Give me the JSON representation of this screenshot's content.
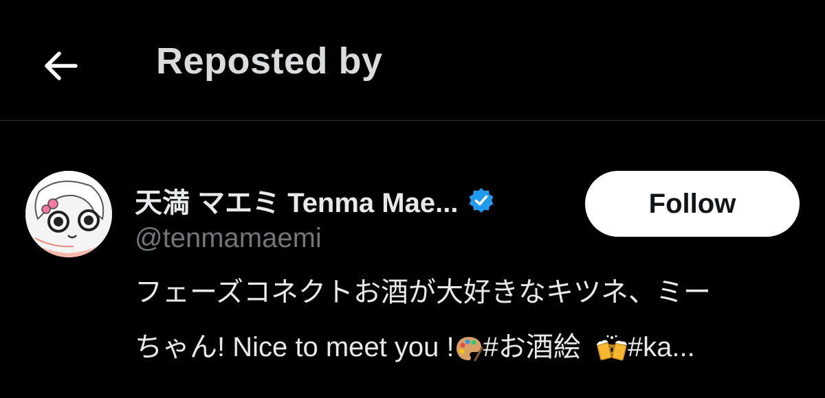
{
  "header": {
    "title": "Reposted by",
    "back_icon": "arrow-left-icon"
  },
  "user": {
    "display_name": "天満 マエミ Tenma Mae...",
    "verified_icon": "verified-badge-icon",
    "verified_color": "#1d9bf0",
    "handle": "@tenmamaemi",
    "follow_label": "Follow",
    "bio_line1": "フェーズコネクトお酒が大好きなキツネ、ミー",
    "bio_line2_part1": "ちゃん! Nice to meet you !",
    "bio_emoji1": "artist-palette-icon",
    "bio_line2_part2": "#お酒絵",
    "bio_emoji2": "beer-mugs-icon",
    "bio_line2_part3": "#ka..."
  }
}
